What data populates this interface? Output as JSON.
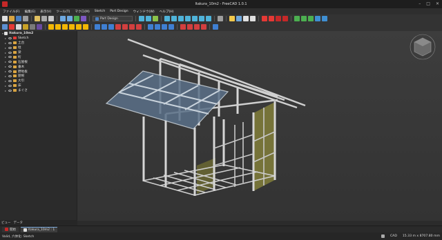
{
  "window": {
    "title": "Itakura_10m2 - FreeCAD 1.0.1"
  },
  "menu": [
    "ファイル(F)",
    "編集(E)",
    "表示(V)",
    "ツール(T)",
    "マクロ(M)",
    "Sketch",
    "Part Design",
    "ウィンドウ(W)",
    "ヘルプ(H)"
  ],
  "toolbar": {
    "workbench": "Part Design"
  },
  "tree": {
    "root": "Itakura_10m2",
    "items": [
      "Sketch",
      "土台",
      "柱",
      "梁",
      "桁",
      "石屋根",
      "垂木",
      "野地板",
      "屋根",
      "大引",
      "床",
      "まぐさ"
    ]
  },
  "panel_tabs": [
    "ビュー",
    "データ"
  ],
  "doc_tabs": [
    "開始",
    "Itakura_10m2 : 1"
  ],
  "status": {
    "left": "Valid, 六体化: Sketch",
    "mode": "CAD",
    "dims": "15.33 m x 8707.80 mm"
  },
  "colors": {
    "accent": "#7aa7d9",
    "wall": "#8c8a3e",
    "roof": "#5a7088",
    "frame": "#cfcfcf"
  }
}
